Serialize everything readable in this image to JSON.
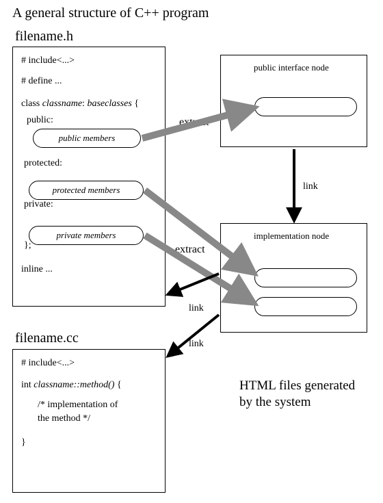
{
  "title": "A general structure of C++ program",
  "header_file": {
    "label": "filename.h",
    "lines": {
      "include": "# include<...>",
      "define": "# define ...",
      "class_decl_prefix": "class ",
      "class_decl_name": "classname",
      "class_decl_mid": ": ",
      "class_decl_bases": "baseclasses",
      "class_decl_suffix": " {",
      "public_kw": "public:",
      "public_members": "public members",
      "protected_kw": "protected:",
      "protected_members": "protected members",
      "private_kw": "private:",
      "private_members": "private members",
      "close": "};",
      "inline": "inline ..."
    }
  },
  "source_file": {
    "label": "filename.cc",
    "lines": {
      "include": "# include<...>",
      "sig_prefix": "int ",
      "sig_name": "classname::method()",
      "sig_suffix": " {",
      "comment1": "/* implementation of",
      "comment2": "   the method */",
      "close": "}"
    }
  },
  "nodes": {
    "public_interface": "public interface node",
    "implementation": "implementation node"
  },
  "edges": {
    "extract1": "extract",
    "extract2": "extract",
    "link1": "link",
    "link2": "link",
    "link3": "link"
  },
  "caption_line1": "HTML files generated",
  "caption_line2": "by the system",
  "colors": {
    "gray_arrow": "#888888",
    "black": "#000000"
  }
}
